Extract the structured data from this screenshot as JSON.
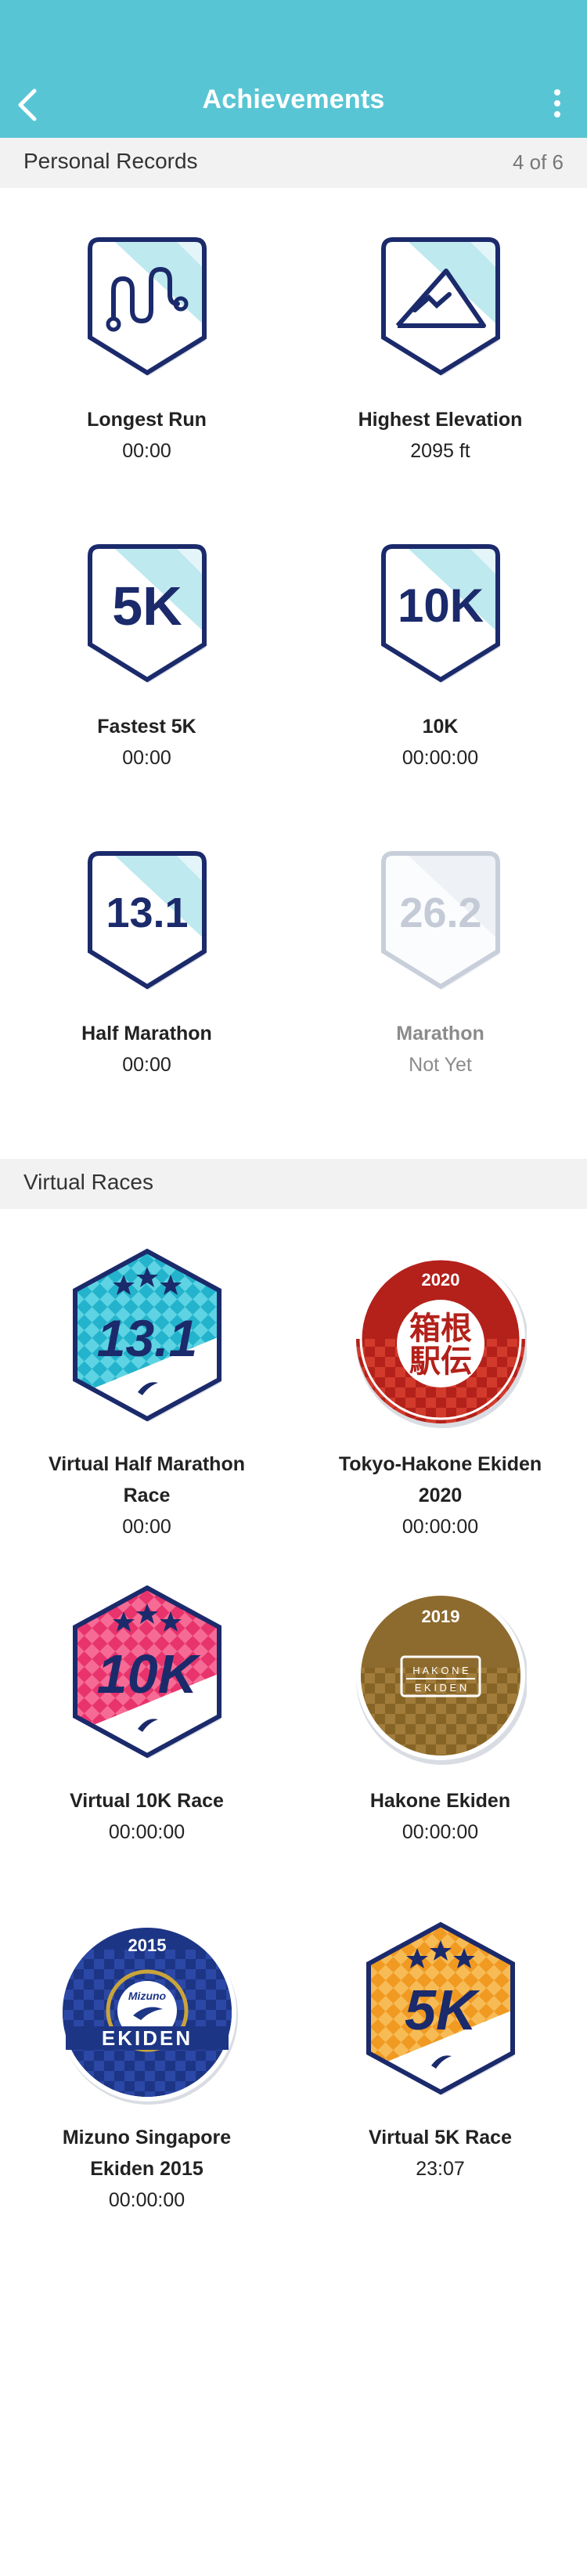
{
  "header": {
    "title": "Achievements"
  },
  "personal_records": {
    "title": "Personal Records",
    "count": "4 of 6",
    "items": [
      {
        "label": "Longest Run",
        "value": "00:00",
        "icon": "wavy-route-icon"
      },
      {
        "label": "Highest Elevation",
        "value": "2095 ft",
        "icon": "mountain-icon"
      },
      {
        "label": "Fastest 5K",
        "value": "00:00",
        "badge_text": "5K"
      },
      {
        "label": "10K",
        "value": "00:00:00",
        "badge_text": "10K"
      },
      {
        "label": "Half Marathon",
        "value": "00:00",
        "badge_text": "13.1"
      },
      {
        "label": "Marathon",
        "value": "Not Yet",
        "badge_text": "26.2"
      }
    ]
  },
  "virtual_races": {
    "title": "Virtual Races",
    "items": [
      {
        "label_line1": "Virtual Half Marathon",
        "label_line2": "Race",
        "value": "00:00",
        "badge_text": "13.1"
      },
      {
        "label_line1": "Tokyo-Hakone Ekiden",
        "label_line2": "2020",
        "value": "00:00:00",
        "badge_year": "2020",
        "badge_text": "箱根駅伝"
      },
      {
        "label_line1": "Virtual 10K Race",
        "value": "00:00:00",
        "badge_text": "10K"
      },
      {
        "label_line1": "Hakone Ekiden",
        "value": "00:00:00",
        "badge_year": "2019",
        "badge_text": "HAKONE EKIDEN"
      },
      {
        "label_line1": "Mizuno Singapore",
        "label_line2": "Ekiden 2015",
        "value": "00:00:00",
        "badge_year": "2015",
        "badge_text": "EKIDEN"
      },
      {
        "label_line1": "Virtual 5K Race",
        "value": "23:07",
        "badge_text": "5K"
      }
    ]
  },
  "colors": {
    "header": "#58c5d4",
    "navy": "#1b2a6b",
    "badge_light": "#bde9ef",
    "hakone_red": "#c0251d",
    "hakone_gold": "#8d6a2e",
    "singapore_blue": "#213a8c",
    "orange": "#f2a12c",
    "pink": "#ea3b73",
    "cyan": "#2bb6cf"
  }
}
